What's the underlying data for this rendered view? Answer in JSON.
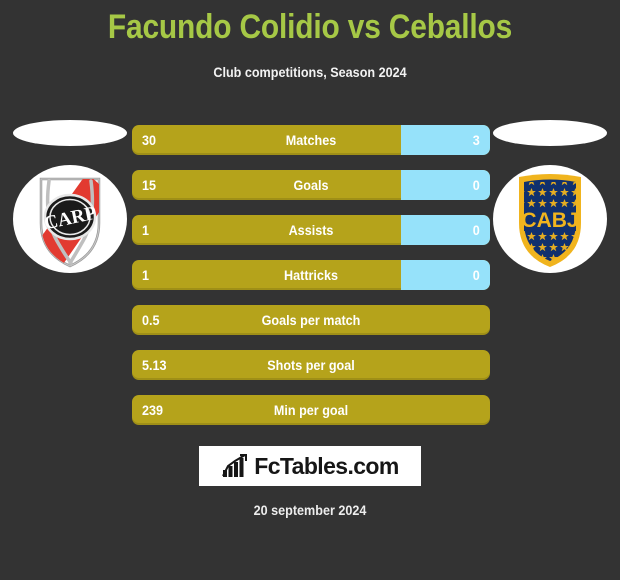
{
  "header": {
    "title": "Facundo Colidio vs Ceballos",
    "subtitle": "Club competitions, Season 2024",
    "title_color": "#A6C846"
  },
  "teams": {
    "left": {
      "crest_name": "river-plate-crest",
      "monogram": "CARP"
    },
    "right": {
      "crest_name": "boca-juniors-crest",
      "monogram": "CABJ"
    }
  },
  "colors": {
    "background": "#333333",
    "bar_left": "#B5A31B",
    "bar_right": "#96E2FA",
    "accent_green": "#A6C846"
  },
  "chart_data": {
    "type": "bar",
    "title": "Facundo Colidio vs Ceballos",
    "subtitle": "Club competitions, Season 2024",
    "categories": [
      "Matches",
      "Goals",
      "Assists",
      "Hattricks",
      "Goals per match",
      "Shots per goal",
      "Min per goal"
    ],
    "series": [
      {
        "name": "Facundo Colidio",
        "values": [
          "30",
          "15",
          "1",
          "1",
          "0.5",
          "5.13",
          "239"
        ]
      },
      {
        "name": "Ceballos",
        "values": [
          "3",
          "0",
          "0",
          "0",
          null,
          null,
          null
        ]
      }
    ],
    "legend": "none",
    "grid": false
  },
  "rows": [
    {
      "label": "Matches",
      "left": "30",
      "right": "3",
      "left_pct": 75,
      "has_right": true
    },
    {
      "label": "Goals",
      "left": "15",
      "right": "0",
      "left_pct": 75,
      "has_right": true
    },
    {
      "label": "Assists",
      "left": "1",
      "right": "0",
      "left_pct": 75,
      "has_right": true
    },
    {
      "label": "Hattricks",
      "left": "1",
      "right": "0",
      "left_pct": 75,
      "has_right": true
    },
    {
      "label": "Goals per match",
      "left": "0.5",
      "right": "",
      "left_pct": 100,
      "has_right": false
    },
    {
      "label": "Shots per goal",
      "left": "5.13",
      "right": "",
      "left_pct": 100,
      "has_right": false
    },
    {
      "label": "Min per goal",
      "left": "239",
      "right": "",
      "left_pct": 100,
      "has_right": false
    }
  ],
  "footer": {
    "brand": "FcTables.com",
    "brand_icon": "bar-chart-growth-icon",
    "date": "20 september 2024"
  }
}
